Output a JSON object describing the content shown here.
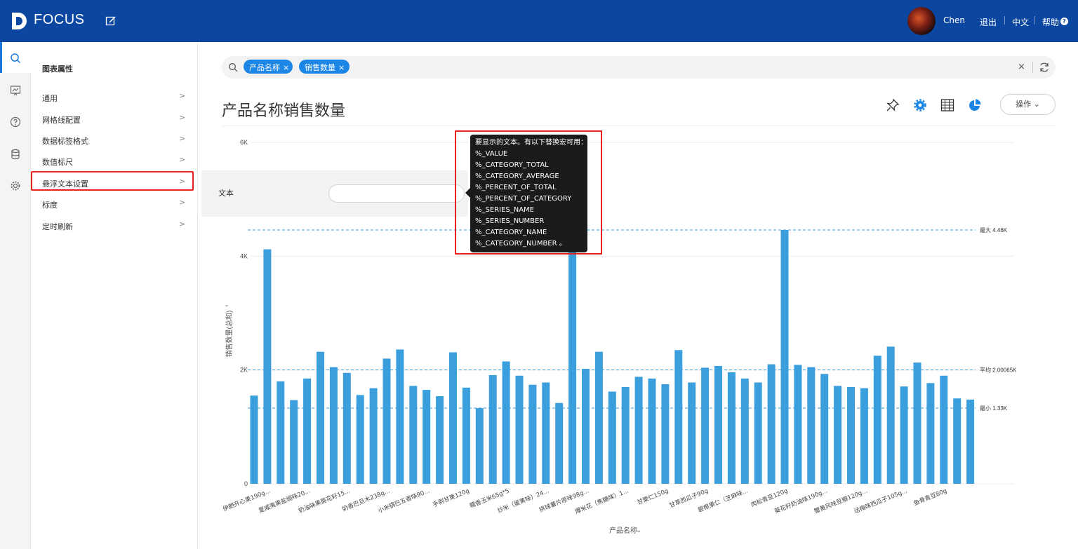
{
  "app": {
    "name": "FOCUS",
    "username": "Chen"
  },
  "header": {
    "logout": "退出",
    "language": "中文",
    "help": "帮助"
  },
  "sidebar_icons": [
    "search-icon",
    "board-icon",
    "help-circle-icon",
    "database-icon",
    "settings-icon"
  ],
  "props": {
    "title": "图表属性",
    "items": [
      {
        "label": "通用"
      },
      {
        "label": "网格线配置"
      },
      {
        "label": "数据标签格式"
      },
      {
        "label": "数值标尺"
      },
      {
        "label": "悬浮文本设置"
      },
      {
        "label": "标度"
      },
      {
        "label": "定时刷新"
      }
    ],
    "selected": "悬浮文本设置"
  },
  "search": {
    "tags": [
      "产品名称",
      "销售数量"
    ]
  },
  "chart_title": "产品名称销售数量",
  "toolbar": {
    "ops_label": "操作"
  },
  "text_setting": {
    "label": "文本",
    "value": ""
  },
  "tooltip": {
    "lines": [
      "要显示的文本。有以下替换宏可用：",
      "%_VALUE",
      "%_CATEGORY_TOTAL",
      "%_CATEGORY_AVERAGE",
      "%_PERCENT_OF_TOTAL",
      "%_PERCENT_OF_CATEGORY",
      "%_SERIES_NAME",
      "%_SERIES_NUMBER",
      "%_CATEGORY_NAME",
      "%_CATEGORY_NUMBER 。"
    ]
  },
  "colors": {
    "bar": "#3a9fdc",
    "accent": "#1c86e6",
    "header": "#0b46a0",
    "highlight": "#e8201f"
  },
  "chart_data": {
    "type": "bar",
    "xlabel": "产品名称",
    "ylabel": "销售数量(总和)",
    "ylim": [
      0,
      6000
    ],
    "yticks": [
      "0",
      "2K",
      "4K",
      "6K"
    ],
    "grid": true,
    "reference_lines": [
      {
        "label": "最大 4.46K",
        "value": 4460
      },
      {
        "label": "平均 2.00065K",
        "value": 2000.65
      },
      {
        "label": "最小 1.33K",
        "value": 1330
      }
    ],
    "category_labels": [
      "伊朗开心果190g...",
      "夏威夷果盐焗味20...",
      "奶油味果葵花籽15...",
      "奶香巴旦木238g...",
      "小米锅巴五香味90...",
      "手剥甘栗120g",
      "糯香玉米65g*5",
      "炒米（蛋黄味）24...",
      "拱球薯片原味98g...",
      "爆米花（焦糖味）1...",
      "甘栗仁150g",
      "甘草西瓜子90g",
      "碧根果仁（芝麻味...",
      "肉松青豆120g",
      "葵花籽奶油味190g...",
      "蟹黄风味豆瓣120g...",
      "话梅味西瓜子105g...",
      "鱼骨青豆80g"
    ],
    "values": [
      1550,
      4120,
      1800,
      1470,
      1850,
      2320,
      2050,
      1950,
      1560,
      1680,
      2200,
      2360,
      1720,
      1650,
      1540,
      2310,
      1690,
      1330,
      1910,
      2150,
      1900,
      1740,
      1780,
      1420,
      4320,
      2020,
      2320,
      1620,
      1700,
      1880,
      1850,
      1750,
      2350,
      1780,
      2040,
      2070,
      1960,
      1850,
      1780,
      2100,
      4460,
      2090,
      2050,
      1930,
      1720,
      1700,
      1680,
      2250,
      2410,
      1710,
      2130,
      1770,
      1900,
      1500,
      1480
    ]
  }
}
